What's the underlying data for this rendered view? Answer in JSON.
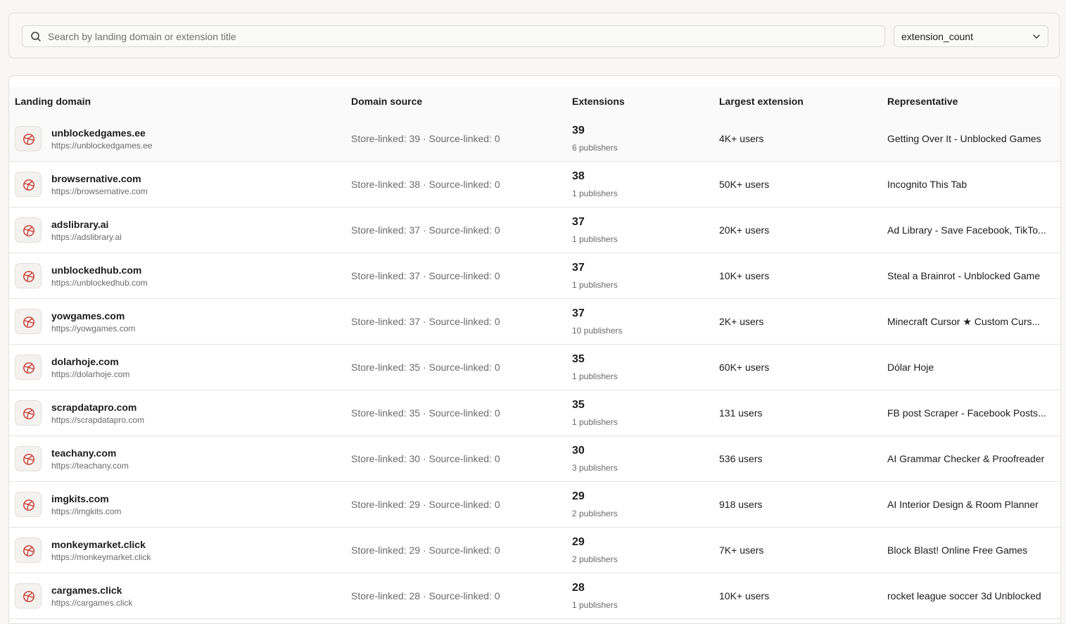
{
  "search": {
    "placeholder": "Search by landing domain or extension title",
    "value": ""
  },
  "sort_select": {
    "value": "extension_count"
  },
  "columns": {
    "landing_domain": "Landing domain",
    "domain_source": "Domain source",
    "extensions": "Extensions",
    "largest_extension": "Largest extension",
    "representative": "Representative"
  },
  "colors": {
    "favicon_icon": "#c8372d",
    "muted_text": "#6a6a6a"
  },
  "rows": [
    {
      "domain": "unblockedgames.ee",
      "url": "https://unblockedgames.ee",
      "source": "Store-linked: 39 · Source-linked: 0",
      "count": "39",
      "publishers": "6 publishers",
      "largest": "4K+ users",
      "representative": "Getting Over It - Unblocked Games"
    },
    {
      "domain": "browsernative.com",
      "url": "https://browsernative.com",
      "source": "Store-linked: 38 · Source-linked: 0",
      "count": "38",
      "publishers": "1 publishers",
      "largest": "50K+ users",
      "representative": "Incognito This Tab"
    },
    {
      "domain": "adslibrary.ai",
      "url": "https://adslibrary.ai",
      "source": "Store-linked: 37 · Source-linked: 0",
      "count": "37",
      "publishers": "1 publishers",
      "largest": "20K+ users",
      "representative": "Ad Library - Save Facebook, TikTo..."
    },
    {
      "domain": "unblockedhub.com",
      "url": "https://unblockedhub.com",
      "source": "Store-linked: 37 · Source-linked: 0",
      "count": "37",
      "publishers": "1 publishers",
      "largest": "10K+ users",
      "representative": "Steal a Brainrot - Unblocked Game"
    },
    {
      "domain": "yowgames.com",
      "url": "https://yowgames.com",
      "source": "Store-linked: 37 · Source-linked: 0",
      "count": "37",
      "publishers": "10 publishers",
      "largest": "2K+ users",
      "representative": "Minecraft Cursor ★ Custom Curs..."
    },
    {
      "domain": "dolarhoje.com",
      "url": "https://dolarhoje.com",
      "source": "Store-linked: 35 · Source-linked: 0",
      "count": "35",
      "publishers": "1 publishers",
      "largest": "60K+ users",
      "representative": "Dólar Hoje"
    },
    {
      "domain": "scrapdatapro.com",
      "url": "https://scrapdatapro.com",
      "source": "Store-linked: 35 · Source-linked: 0",
      "count": "35",
      "publishers": "1 publishers",
      "largest": "131 users",
      "representative": "FB post Scraper - Facebook Posts..."
    },
    {
      "domain": "teachany.com",
      "url": "https://teachany.com",
      "source": "Store-linked: 30 · Source-linked: 0",
      "count": "30",
      "publishers": "3 publishers",
      "largest": "536 users",
      "representative": "AI Grammar Checker & Proofreader"
    },
    {
      "domain": "imgkits.com",
      "url": "https://imgkits.com",
      "source": "Store-linked: 29 · Source-linked: 0",
      "count": "29",
      "publishers": "2 publishers",
      "largest": "918 users",
      "representative": "AI Interior Design & Room Planner"
    },
    {
      "domain": "monkeymarket.click",
      "url": "https://monkeymarket.click",
      "source": "Store-linked: 29 · Source-linked: 0",
      "count": "29",
      "publishers": "2 publishers",
      "largest": "7K+ users",
      "representative": "Block Blast! Online Free Games"
    },
    {
      "domain": "cargames.click",
      "url": "https://cargames.click",
      "source": "Store-linked: 28 · Source-linked: 0",
      "count": "28",
      "publishers": "1 publishers",
      "largest": "10K+ users",
      "representative": "rocket league soccer 3d Unblocked"
    }
  ]
}
